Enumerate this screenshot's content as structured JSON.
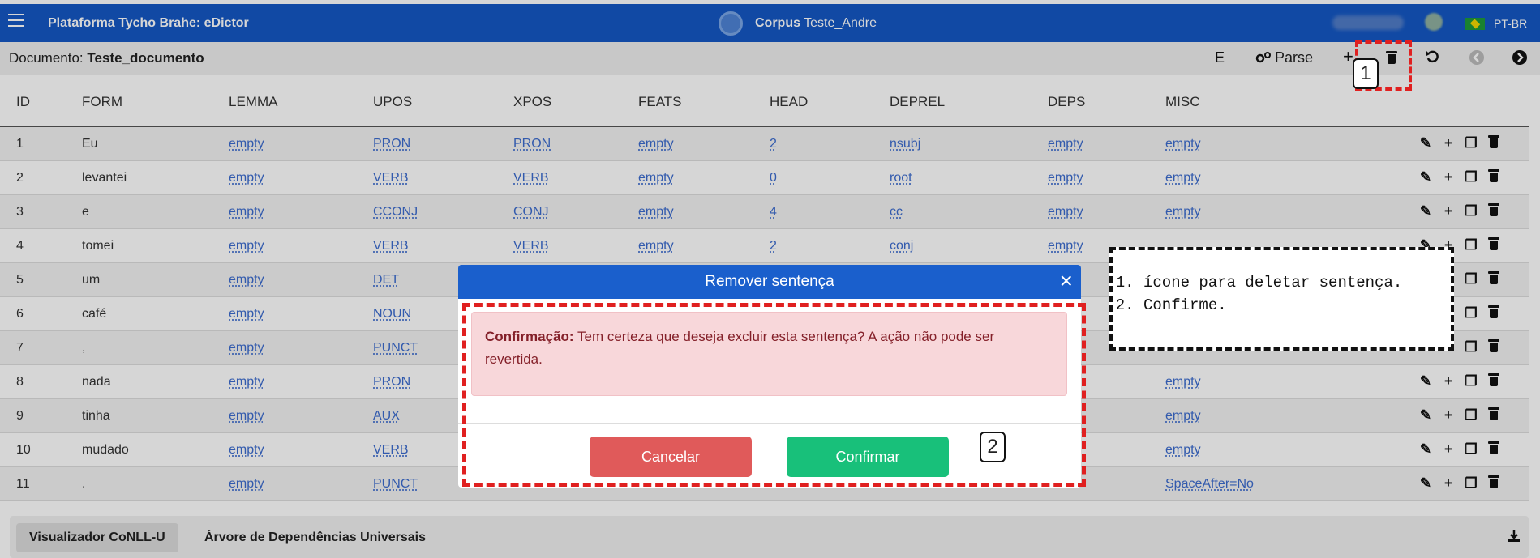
{
  "navbar": {
    "brand": "Plataforma Tycho Brahe: eDictor",
    "corpus_label": "Corpus",
    "corpus_name": "Teste_Andre",
    "language": "PT-BR"
  },
  "document": {
    "label": "Documento:",
    "name": "Teste_documento"
  },
  "toolbar": {
    "e_label": "E",
    "parse_label": "Parse",
    "add_label": "+"
  },
  "table": {
    "headers": [
      "ID",
      "FORM",
      "LEMMA",
      "UPOS",
      "XPOS",
      "FEATS",
      "HEAD",
      "DEPREL",
      "DEPS",
      "MISC"
    ],
    "rows": [
      {
        "id": "1",
        "form": "Eu",
        "lemma": "empty",
        "upos": "PRON",
        "xpos": "PRON",
        "feats": "empty",
        "head": "2",
        "deprel": "nsubj",
        "deps": "empty",
        "misc": "empty"
      },
      {
        "id": "2",
        "form": "levantei",
        "lemma": "empty",
        "upos": "VERB",
        "xpos": "VERB",
        "feats": "empty",
        "head": "0",
        "deprel": "root",
        "deps": "empty",
        "misc": "empty"
      },
      {
        "id": "3",
        "form": "e",
        "lemma": "empty",
        "upos": "CCONJ",
        "xpos": "CONJ",
        "feats": "empty",
        "head": "4",
        "deprel": "cc",
        "deps": "empty",
        "misc": "empty"
      },
      {
        "id": "4",
        "form": "tomei",
        "lemma": "empty",
        "upos": "VERB",
        "xpos": "VERB",
        "feats": "empty",
        "head": "2",
        "deprel": "conj",
        "deps": "empty",
        "misc": ""
      },
      {
        "id": "5",
        "form": "um",
        "lemma": "empty",
        "upos": "DET",
        "xpos": "",
        "feats": "",
        "head": "",
        "deprel": "",
        "deps": "",
        "misc": ""
      },
      {
        "id": "6",
        "form": "café",
        "lemma": "empty",
        "upos": "NOUN",
        "xpos": "",
        "feats": "",
        "head": "",
        "deprel": "",
        "deps": "",
        "misc": ""
      },
      {
        "id": "7",
        "form": ",",
        "lemma": "empty",
        "upos": "PUNCT",
        "xpos": "",
        "feats": "",
        "head": "",
        "deprel": "",
        "deps": "",
        "misc": ""
      },
      {
        "id": "8",
        "form": "nada",
        "lemma": "empty",
        "upos": "PRON",
        "xpos": "",
        "feats": "",
        "head": "",
        "deprel": "",
        "deps": "",
        "misc": "empty"
      },
      {
        "id": "9",
        "form": "tinha",
        "lemma": "empty",
        "upos": "AUX",
        "xpos": "",
        "feats": "",
        "head": "",
        "deprel": "",
        "deps": "",
        "misc": "empty"
      },
      {
        "id": "10",
        "form": "mudado",
        "lemma": "empty",
        "upos": "VERB",
        "xpos": "",
        "feats": "",
        "head": "",
        "deprel": "",
        "deps": "",
        "misc": "empty"
      },
      {
        "id": "11",
        "form": ".",
        "lemma": "empty",
        "upos": "PUNCT",
        "xpos": "",
        "feats": "",
        "head": "",
        "deprel": "",
        "deps": "",
        "misc": "SpaceAfter=No"
      }
    ]
  },
  "bottom_tabs": [
    "Visualizador CoNLL-U",
    "Árvore de Dependências Universais"
  ],
  "modal": {
    "title": "Remover sentença",
    "close_label": "×",
    "alert_strong": "Confirmação:",
    "alert_text": " Tem certeza que deseja excluir esta sentença? A ação não pode ser revertida.",
    "cancel_label": "Cancelar",
    "confirm_label": "Confirmar"
  },
  "annotations": {
    "badge1": "1",
    "badge2": "2",
    "note_items": [
      "ícone para deletar sentença.",
      "Confirme."
    ]
  },
  "colors": {
    "navbar": "#1558c4",
    "modal_header": "#1a5fcc",
    "cancel": "#e05a5a",
    "confirm": "#18c07a",
    "alert_bg": "#f8d7da",
    "annotation_red": "#e02020"
  }
}
